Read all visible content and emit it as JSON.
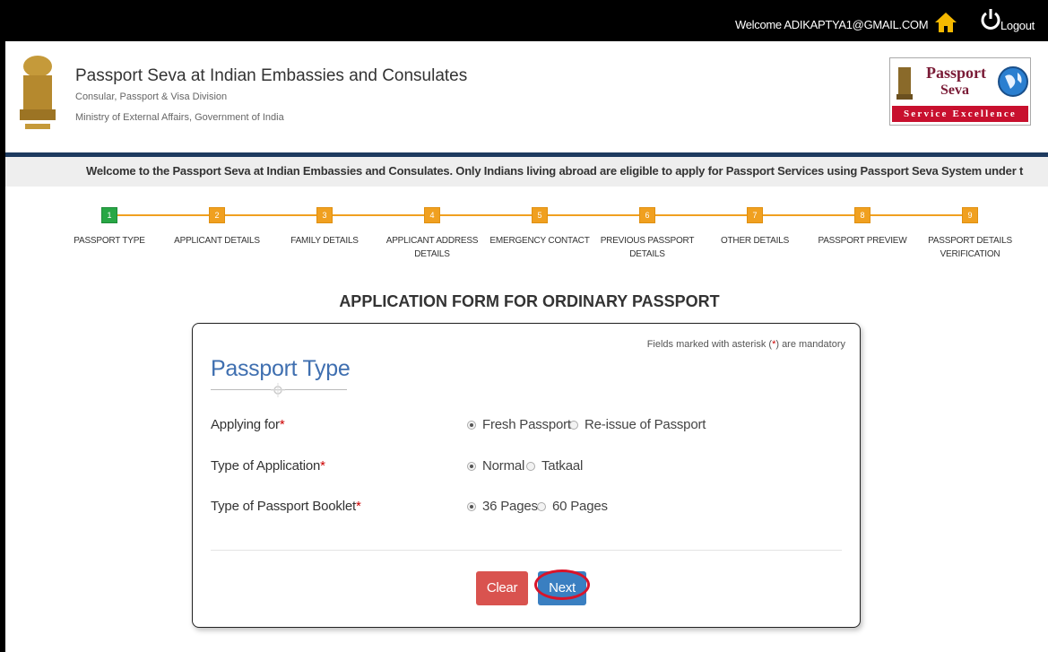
{
  "topbar": {
    "welcome": "Welcome ADIKAPTYA1@GMAIL.COM",
    "home_icon": "home-icon",
    "logout_icon": "power-icon",
    "logout_label": "Logout"
  },
  "header": {
    "title": "Passport Seva at Indian Embassies and Consulates",
    "sub1": "Consular, Passport & Visa Division",
    "sub2": "Ministry of External Affairs, Government of India",
    "logo_line1": "Passport",
    "logo_line2": "Seva",
    "logo_strip": "Service Excellence"
  },
  "marquee": "Welcome to the Passport Seva at Indian Embassies and Consulates. Only Indians living abroad are eligible to apply for Passport Services using Passport Seva System under t",
  "steps": [
    {
      "num": "1",
      "label": "PASSPORT TYPE",
      "active": true
    },
    {
      "num": "2",
      "label": "APPLICANT DETAILS",
      "active": false
    },
    {
      "num": "3",
      "label": "FAMILY DETAILS",
      "active": false
    },
    {
      "num": "4",
      "label": "APPLICANT ADDRESS DETAILS",
      "active": false
    },
    {
      "num": "5",
      "label": "EMERGENCY CONTACT",
      "active": false
    },
    {
      "num": "6",
      "label": "PREVIOUS PASSPORT DETAILS",
      "active": false
    },
    {
      "num": "7",
      "label": "OTHER DETAILS",
      "active": false
    },
    {
      "num": "8",
      "label": "PASSPORT PREVIEW",
      "active": false
    },
    {
      "num": "9",
      "label": "PASSPORT DETAILS VERIFICATION",
      "active": false
    }
  ],
  "form": {
    "title": "APPLICATION FORM FOR ORDINARY PASSPORT",
    "mandatory_pre": "Fields marked with asterisk (",
    "mandatory_star": "*",
    "mandatory_post": ") are mandatory",
    "section_title": "Passport Type",
    "rows": [
      {
        "label": "Applying for",
        "options": [
          "Fresh Passport",
          "Re-issue of Passport"
        ],
        "selected": 0
      },
      {
        "label": "Type of Application",
        "options": [
          "Normal",
          "Tatkaal"
        ],
        "selected": 0
      },
      {
        "label": "Type of Passport Booklet",
        "options": [
          "36 Pages",
          "60 Pages"
        ],
        "selected": 0
      }
    ],
    "required_mark": "*",
    "clear_label": "Clear",
    "next_label": "Next"
  },
  "colors": {
    "step_active": "#28a745",
    "step_pending": "#f0a020",
    "heading_blue": "#3f6fb0",
    "clear_btn": "#d9534f",
    "next_btn": "#3a7fc1",
    "highlight_ring": "#d8142a"
  }
}
